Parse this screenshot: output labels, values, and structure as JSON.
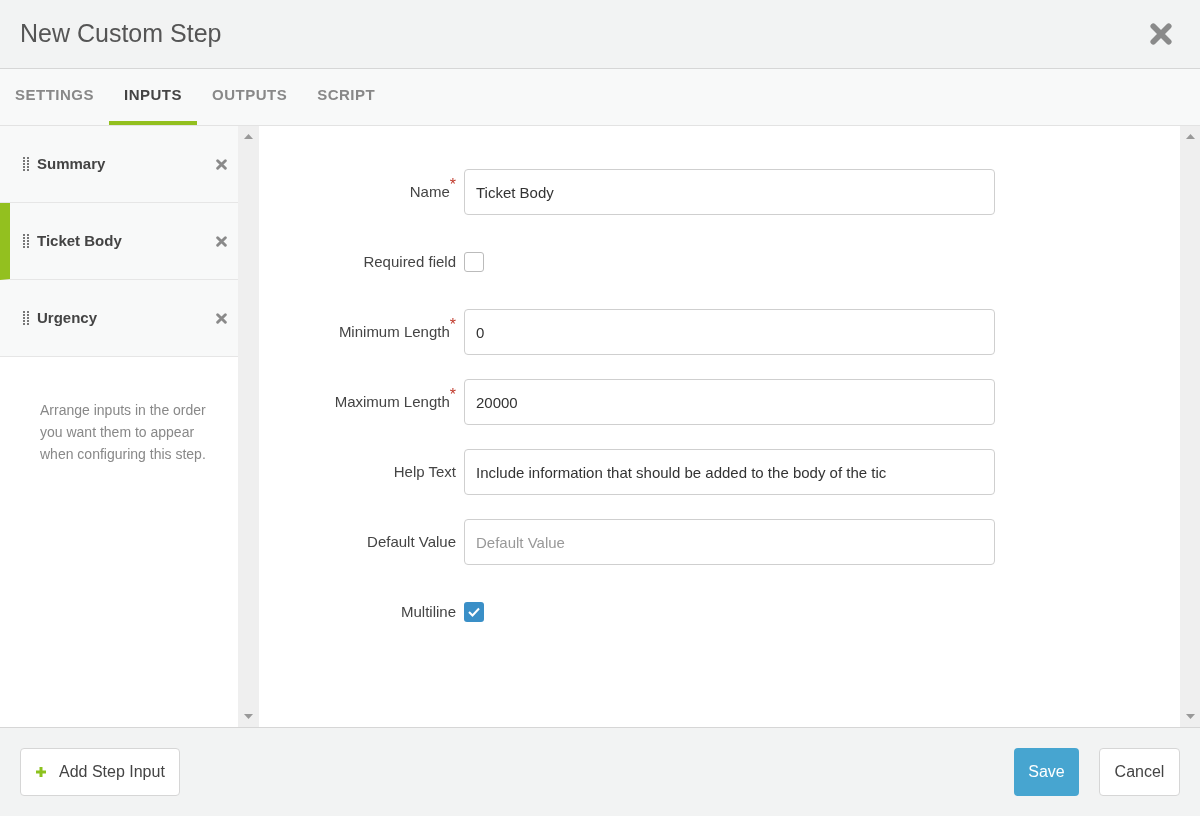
{
  "window": {
    "title": "New Custom Step"
  },
  "tabs": [
    {
      "label": "SETTINGS",
      "selected": false
    },
    {
      "label": "INPUTS",
      "selected": true
    },
    {
      "label": "OUTPUTS",
      "selected": false
    },
    {
      "label": "SCRIPT",
      "selected": false
    }
  ],
  "sidebar": {
    "items": [
      {
        "label": "Summary",
        "selected": false
      },
      {
        "label": "Ticket Body",
        "selected": true
      },
      {
        "label": "Urgency",
        "selected": false
      }
    ],
    "hint": "Arrange inputs in the order you want them to appear when configuring this step."
  },
  "form": {
    "fields": [
      {
        "kind": "text",
        "label": "Name",
        "required_mark": "*",
        "value": "Ticket Body"
      },
      {
        "kind": "checkbox",
        "label": "Required field",
        "checked": false
      },
      {
        "kind": "text",
        "label": "Minimum Length",
        "required_mark": "*",
        "value": "0"
      },
      {
        "kind": "text",
        "label": "Maximum Length",
        "required_mark": "*",
        "value": "20000"
      },
      {
        "kind": "text",
        "label": "Help Text",
        "value": "Include information that should be added to the body of the tic"
      },
      {
        "kind": "text",
        "label": "Default Value",
        "placeholder": "Default Value"
      },
      {
        "kind": "checkbox",
        "label": "Multiline",
        "checked": true
      }
    ]
  },
  "footer": {
    "add_button": "Add Step Input",
    "save_button": "Save",
    "cancel_button": "Cancel"
  }
}
